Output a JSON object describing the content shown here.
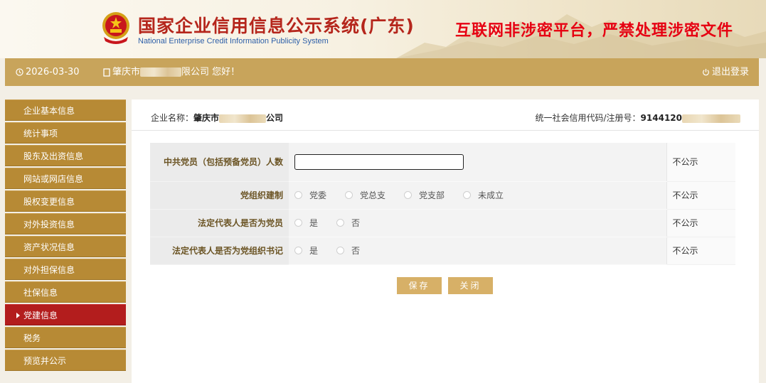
{
  "header": {
    "title_cn": "国家企业信用信息公示系统(广东)",
    "title_en": "National Enterprise Credit Information Publicity System",
    "warning": "互联网非涉密平台，严禁处理涉密文件",
    "emblem_icon": "national-emblem-icon"
  },
  "topbar": {
    "date": "2026-03-30",
    "greeting_prefix": "肇庆市",
    "greeting_suffix": "限公司 您好！",
    "logout": "退出登录"
  },
  "sidebar": {
    "items": [
      {
        "label": "企业基本信息",
        "active": false
      },
      {
        "label": "统计事项",
        "active": false
      },
      {
        "label": "股东及出资信息",
        "active": false
      },
      {
        "label": "网站或网店信息",
        "active": false
      },
      {
        "label": "股权变更信息",
        "active": false
      },
      {
        "label": "对外投资信息",
        "active": false
      },
      {
        "label": "资产状况信息",
        "active": false
      },
      {
        "label": "对外担保信息",
        "active": false
      },
      {
        "label": "社保信息",
        "active": false
      },
      {
        "label": "党建信息",
        "active": true
      },
      {
        "label": "税务",
        "active": false
      },
      {
        "label": "预览并公示",
        "active": false
      }
    ]
  },
  "company": {
    "name_label": "企业名称：",
    "name_prefix": "肇庆市",
    "name_suffix": "公司",
    "code_label": "统一社会信用代码/注册号：",
    "code_prefix": "9144120"
  },
  "form": {
    "rows": [
      {
        "label": "中共党员（包括预备党员）人数",
        "type": "input",
        "value": "",
        "publicity": "不公示"
      },
      {
        "label": "党组织建制",
        "type": "radio",
        "options": [
          "党委",
          "党总支",
          "党支部",
          "未成立"
        ],
        "publicity": "不公示"
      },
      {
        "label": "法定代表人是否为党员",
        "type": "radio",
        "options": [
          "是",
          "否"
        ],
        "publicity": "不公示"
      },
      {
        "label": "法定代表人是否为党组织书记",
        "type": "radio",
        "options": [
          "是",
          "否"
        ],
        "publicity": "不公示"
      }
    ]
  },
  "buttons": {
    "save": "保存",
    "close": "关闭"
  },
  "colors": {
    "brand_gold": "#c8a45b",
    "sidebar_item": "#b78a35",
    "sidebar_active": "#b31d1d",
    "title_red": "#b5261c",
    "warning_red": "#e60012",
    "button_gold": "#d7b067"
  }
}
